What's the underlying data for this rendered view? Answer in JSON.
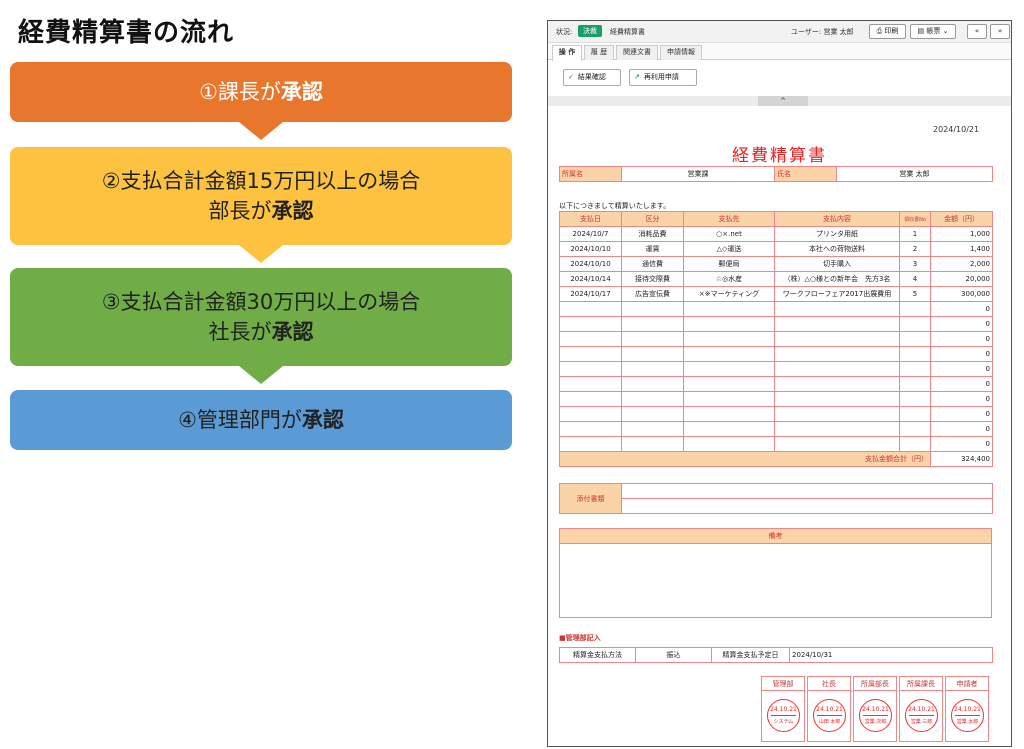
{
  "flow": {
    "title": "経費精算書の流れ",
    "steps": [
      {
        "pre": "①課長が",
        "bold": "承認"
      },
      {
        "line1": "②支払合計金額15万円以上の場合",
        "pre": "部長が",
        "bold": "承認"
      },
      {
        "line1": "③支払合計金額30万円以上の場合",
        "pre": "社長が",
        "bold": "承認"
      },
      {
        "pre": "④管理部門が",
        "bold": "承認"
      }
    ],
    "colors": {
      "step1": "#e8762d",
      "step2": "#fdc340",
      "step3": "#70ad47",
      "step4": "#5b9bd5"
    }
  },
  "app": {
    "status_label": "状況:",
    "status_badge": "決裁",
    "doc_name": "経費精算書",
    "user_label": "ユーザー: 営業 太郎",
    "print_button": "印刷",
    "form_button": "帳票",
    "first_button": "«",
    "last_button": "»",
    "tabs": [
      "操 作",
      "履 歴",
      "関連文書",
      "申請情報"
    ],
    "confirm_button": "結果確認",
    "reapply_button": "再利用申請",
    "collapse_icon": "^"
  },
  "document": {
    "date": "2024/10/21",
    "title": "経費精算書",
    "dept_label": "所属名",
    "dept_value": "営業課",
    "name_label": "氏名",
    "name_value": "営業 太郎",
    "intro": "以下につきまして精算いたします。",
    "columns": [
      "支払日",
      "区分",
      "支払先",
      "支払内容",
      "領収書No",
      "金額（円）"
    ],
    "rows": [
      [
        "2024/10/7",
        "消耗品費",
        "○×.net",
        "プリンタ用紙",
        "1",
        "1,000"
      ],
      [
        "2024/10/10",
        "運賃",
        "△◇運送",
        "本社への荷物送料",
        "2",
        "1,400"
      ],
      [
        "2024/10/10",
        "通信費",
        "郵便局",
        "切手購入",
        "3",
        "2,000"
      ],
      [
        "2024/10/14",
        "接待交際費",
        "☆◎水産",
        "（株）△○様との新年会　先方3名",
        "4",
        "20,000"
      ],
      [
        "2024/10/17",
        "広告宣伝費",
        "×※マーケティング",
        "ワークフローフェア2017出展費用",
        "5",
        "300,000"
      ],
      [
        "",
        "",
        "",
        "",
        "",
        "0"
      ],
      [
        "",
        "",
        "",
        "",
        "",
        "0"
      ],
      [
        "",
        "",
        "",
        "",
        "",
        "0"
      ],
      [
        "",
        "",
        "",
        "",
        "",
        "0"
      ],
      [
        "",
        "",
        "",
        "",
        "",
        "0"
      ],
      [
        "",
        "",
        "",
        "",
        "",
        "0"
      ],
      [
        "",
        "",
        "",
        "",
        "",
        "0"
      ],
      [
        "",
        "",
        "",
        "",
        "",
        "0"
      ],
      [
        "",
        "",
        "",
        "",
        "",
        "0"
      ],
      [
        "",
        "",
        "",
        "",
        "",
        "0"
      ]
    ],
    "total_label": "支払金額合計（円）",
    "total_value": "324,400",
    "attach_label": "添付書類",
    "remarks_label": "備考",
    "mgmt_section": "■管理部記入",
    "method_label": "精算金支払方法",
    "method_value": "振込",
    "paydate_label": "精算金支払予定日",
    "paydate_value": "2024/10/31",
    "stamps": [
      {
        "label": "管理部",
        "date": "24.10.21",
        "name": "システム"
      },
      {
        "label": "社長",
        "date": "24.10.21",
        "name": "山田 太郎"
      },
      {
        "label": "所属部長",
        "date": "24.10.21",
        "name": "営業 次郎"
      },
      {
        "label": "所属課長",
        "date": "24.10.21",
        "name": "営業 三郎"
      },
      {
        "label": "申請者",
        "date": "24.10.21",
        "name": "営業 太郎"
      }
    ]
  }
}
